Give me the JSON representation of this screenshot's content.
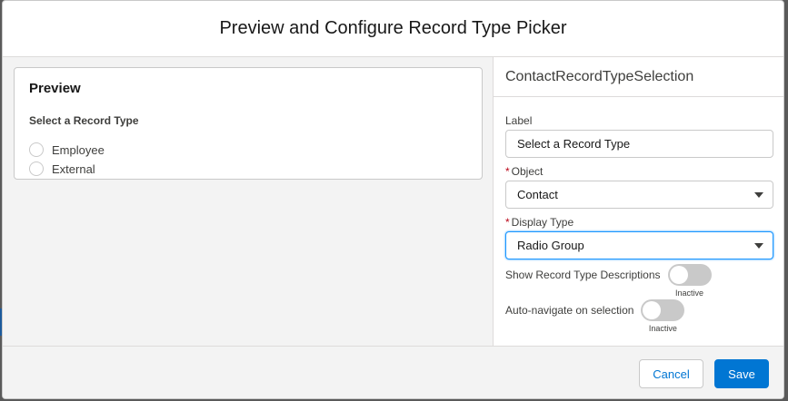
{
  "modal": {
    "title": "Preview and Configure Record Type Picker"
  },
  "preview": {
    "title": "Preview",
    "picker_label": "Select a Record Type",
    "options": [
      "Employee",
      "External"
    ]
  },
  "config": {
    "component_name": "ContactRecordTypeSelection",
    "label": {
      "label": "Label",
      "value": "Select a Record Type"
    },
    "object": {
      "label": "Object",
      "value": "Contact",
      "required_marker": "*"
    },
    "display_type": {
      "label": "Display Type",
      "value": "Radio Group",
      "required_marker": "*"
    },
    "show_descriptions": {
      "label": "Show Record Type Descriptions",
      "state": "Inactive"
    },
    "auto_navigate": {
      "label": "Auto-navigate on selection",
      "state": "Inactive"
    }
  },
  "footer": {
    "cancel_label": "Cancel",
    "save_label": "Save"
  },
  "colors": {
    "brand": "#0176d3",
    "required": "#ba0517",
    "focus": "#1b96ff"
  }
}
